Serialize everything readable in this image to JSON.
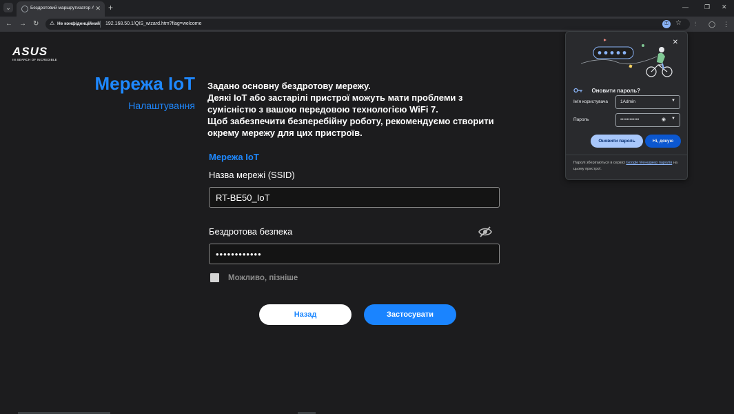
{
  "browser": {
    "tab_title": "Бездротовий маршрутизатор А",
    "tab_close": "✕",
    "new_tab": "+",
    "tab_list": "⌄",
    "win_min": "—",
    "win_max": "❐",
    "win_close": "✕",
    "nav_back": "←",
    "nav_forward": "→",
    "nav_reload": "↻",
    "omni_warning": "⚠",
    "omni_secure_label": "Не конфіденційний",
    "url": "192.168.50.1/QIS_wizard.htm?flag=welcome",
    "omni_key": "⚿",
    "omni_star": "☆",
    "toolbar_cast": "⫶",
    "toolbar_profile": "◯",
    "toolbar_menu": "⋮"
  },
  "brand": {
    "logo": "ASUS",
    "tagline": "IN SEARCH OF INCREDIBLE"
  },
  "step": {
    "title": "Мережа IoT",
    "subtitle": "Налаштування"
  },
  "description": [
    "Задано основну бездротову мережу.",
    "Деякі IoT або застарілі пристрої можуть мати проблеми з",
    "сумісністю з вашою передовою технологією WiFi 7.",
    "Щоб забезпечити безперебійну роботу, рекомендуємо створити",
    "окрему мережу для цих пристроїв."
  ],
  "form": {
    "section_label": "Мережа IoT",
    "ssid_label": "Назва мережі (SSID)",
    "ssid_value": "RT-BE50_IoT",
    "security_label": "Бездротова безпека",
    "security_value": "••••••••••••",
    "later_label": "Можливо, пізніше",
    "later_checked": false
  },
  "buttons": {
    "back": "Назад",
    "apply": "Застосувати"
  },
  "password_popup": {
    "close": "✕",
    "title": "Оновити пароль?",
    "username_label": "Ім'я користувача",
    "username_value": "1Admin",
    "password_label": "Пароль",
    "password_value": "••••••••••••",
    "update_button": "Оновити пароль",
    "no_button": "Ні, дякую",
    "footer_pre": "Паролі зберігаються в сервісі ",
    "footer_link": "Google Менеджер паролів",
    "footer_post": " на цьому пристрої."
  },
  "colors": {
    "accent": "#1e88ff",
    "page_bg": "#1c1c1e",
    "popup_primary": "#a8c7fa",
    "popup_secondary": "#0b57d0"
  }
}
